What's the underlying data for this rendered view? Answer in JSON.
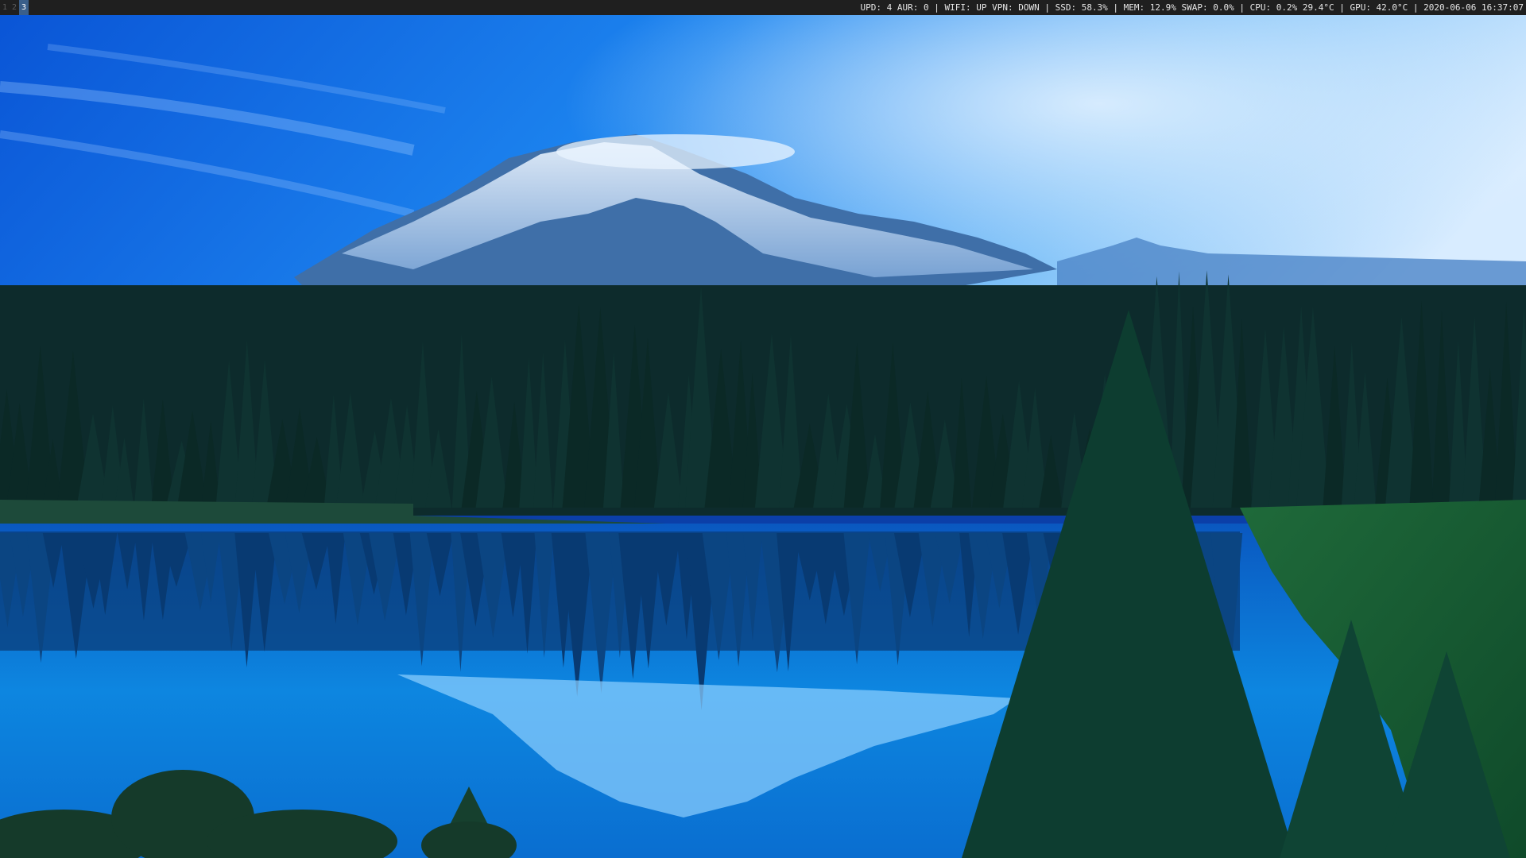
{
  "bar": {
    "workspaces": [
      {
        "label": "1",
        "active": false
      },
      {
        "label": "2",
        "active": false
      },
      {
        "label": "3",
        "active": true
      }
    ],
    "status": "UPD: 4 AUR: 0 | WIFI: UP VPN: DOWN | SSD: 58.3% | MEM: 12.9% SWAP: 0.0% | CPU: 0.2% 29.4°C | GPU: 42.0°C | 2020-06-06 16:37:07"
  },
  "colors": {
    "bar_bg": "#1f1f1f",
    "bar_text": "#e6e6e6",
    "active_workspace": "#3a5f8a",
    "sky_top": "#0a4fd0",
    "sky_glow": "#cfe6ff",
    "forest": "#0c2a2a",
    "lake": "#0a7ad8"
  }
}
